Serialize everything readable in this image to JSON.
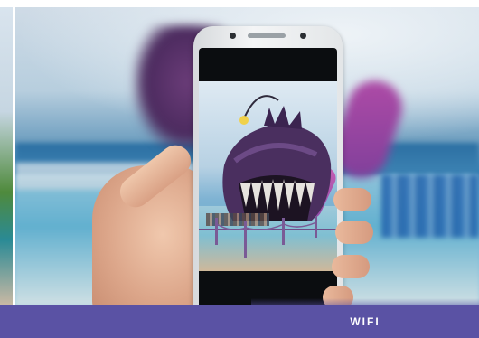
{
  "banner": {
    "label": "WIFI"
  },
  "colors": {
    "banner_background": "#5a52a4",
    "banner_text": "#ffffff",
    "page_background": "#ffffff"
  },
  "icons": {
    "anglerfish": "anglerfish-sculpture-icon"
  }
}
